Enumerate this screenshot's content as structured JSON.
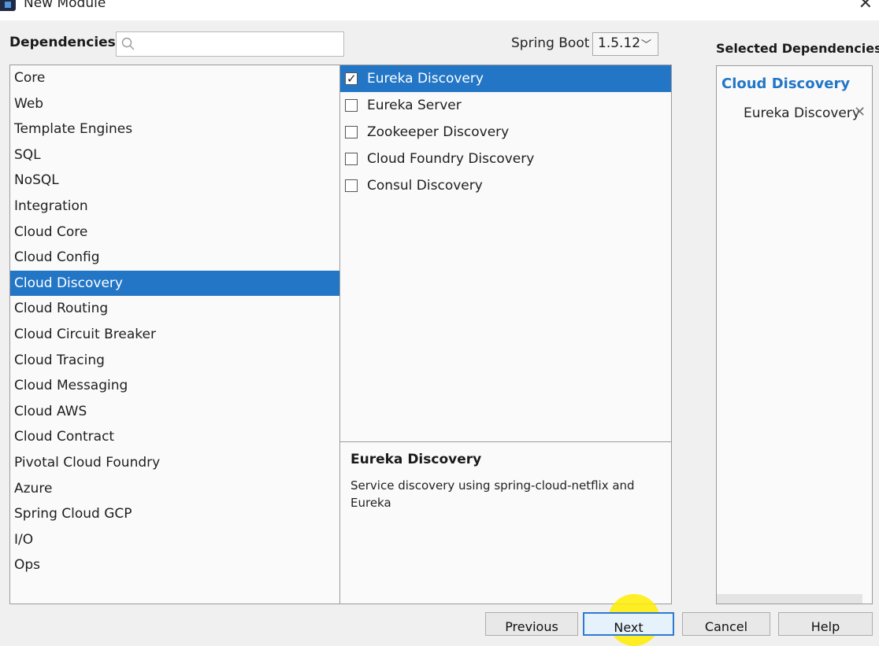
{
  "window": {
    "title": "New Module"
  },
  "header": {
    "dependencies_label": "Dependencies",
    "search_value": "",
    "spring_boot_label": "Spring Boot",
    "spring_boot_version": "1.5.12"
  },
  "categories": [
    {
      "label": "Core"
    },
    {
      "label": "Web"
    },
    {
      "label": "Template Engines"
    },
    {
      "label": "SQL"
    },
    {
      "label": "NoSQL"
    },
    {
      "label": "Integration"
    },
    {
      "label": "Cloud Core"
    },
    {
      "label": "Cloud Config"
    },
    {
      "label": "Cloud Discovery",
      "selected": true
    },
    {
      "label": "Cloud Routing"
    },
    {
      "label": "Cloud Circuit Breaker"
    },
    {
      "label": "Cloud Tracing"
    },
    {
      "label": "Cloud Messaging"
    },
    {
      "label": "Cloud AWS"
    },
    {
      "label": "Cloud Contract"
    },
    {
      "label": "Pivotal Cloud Foundry"
    },
    {
      "label": "Azure"
    },
    {
      "label": "Spring Cloud GCP"
    },
    {
      "label": "I/O"
    },
    {
      "label": "Ops"
    }
  ],
  "dependencies": [
    {
      "label": "Eureka Discovery",
      "checked": true,
      "selected": true
    },
    {
      "label": "Eureka Server",
      "checked": false
    },
    {
      "label": "Zookeeper Discovery",
      "checked": false
    },
    {
      "label": "Cloud Foundry Discovery",
      "checked": false
    },
    {
      "label": "Consul Discovery",
      "checked": false
    }
  ],
  "description": {
    "title": "Eureka Discovery",
    "text": "Service discovery using spring-cloud-netflix and Eureka"
  },
  "selected_panel": {
    "heading": "Selected Dependencies",
    "group": "Cloud Discovery",
    "items": [
      "Eureka Discovery"
    ]
  },
  "buttons": {
    "previous": "Previous",
    "next": "Next",
    "cancel": "Cancel",
    "help": "Help"
  },
  "colors": {
    "accent": "#2376c6",
    "cursor_highlight": "#ffec00"
  }
}
